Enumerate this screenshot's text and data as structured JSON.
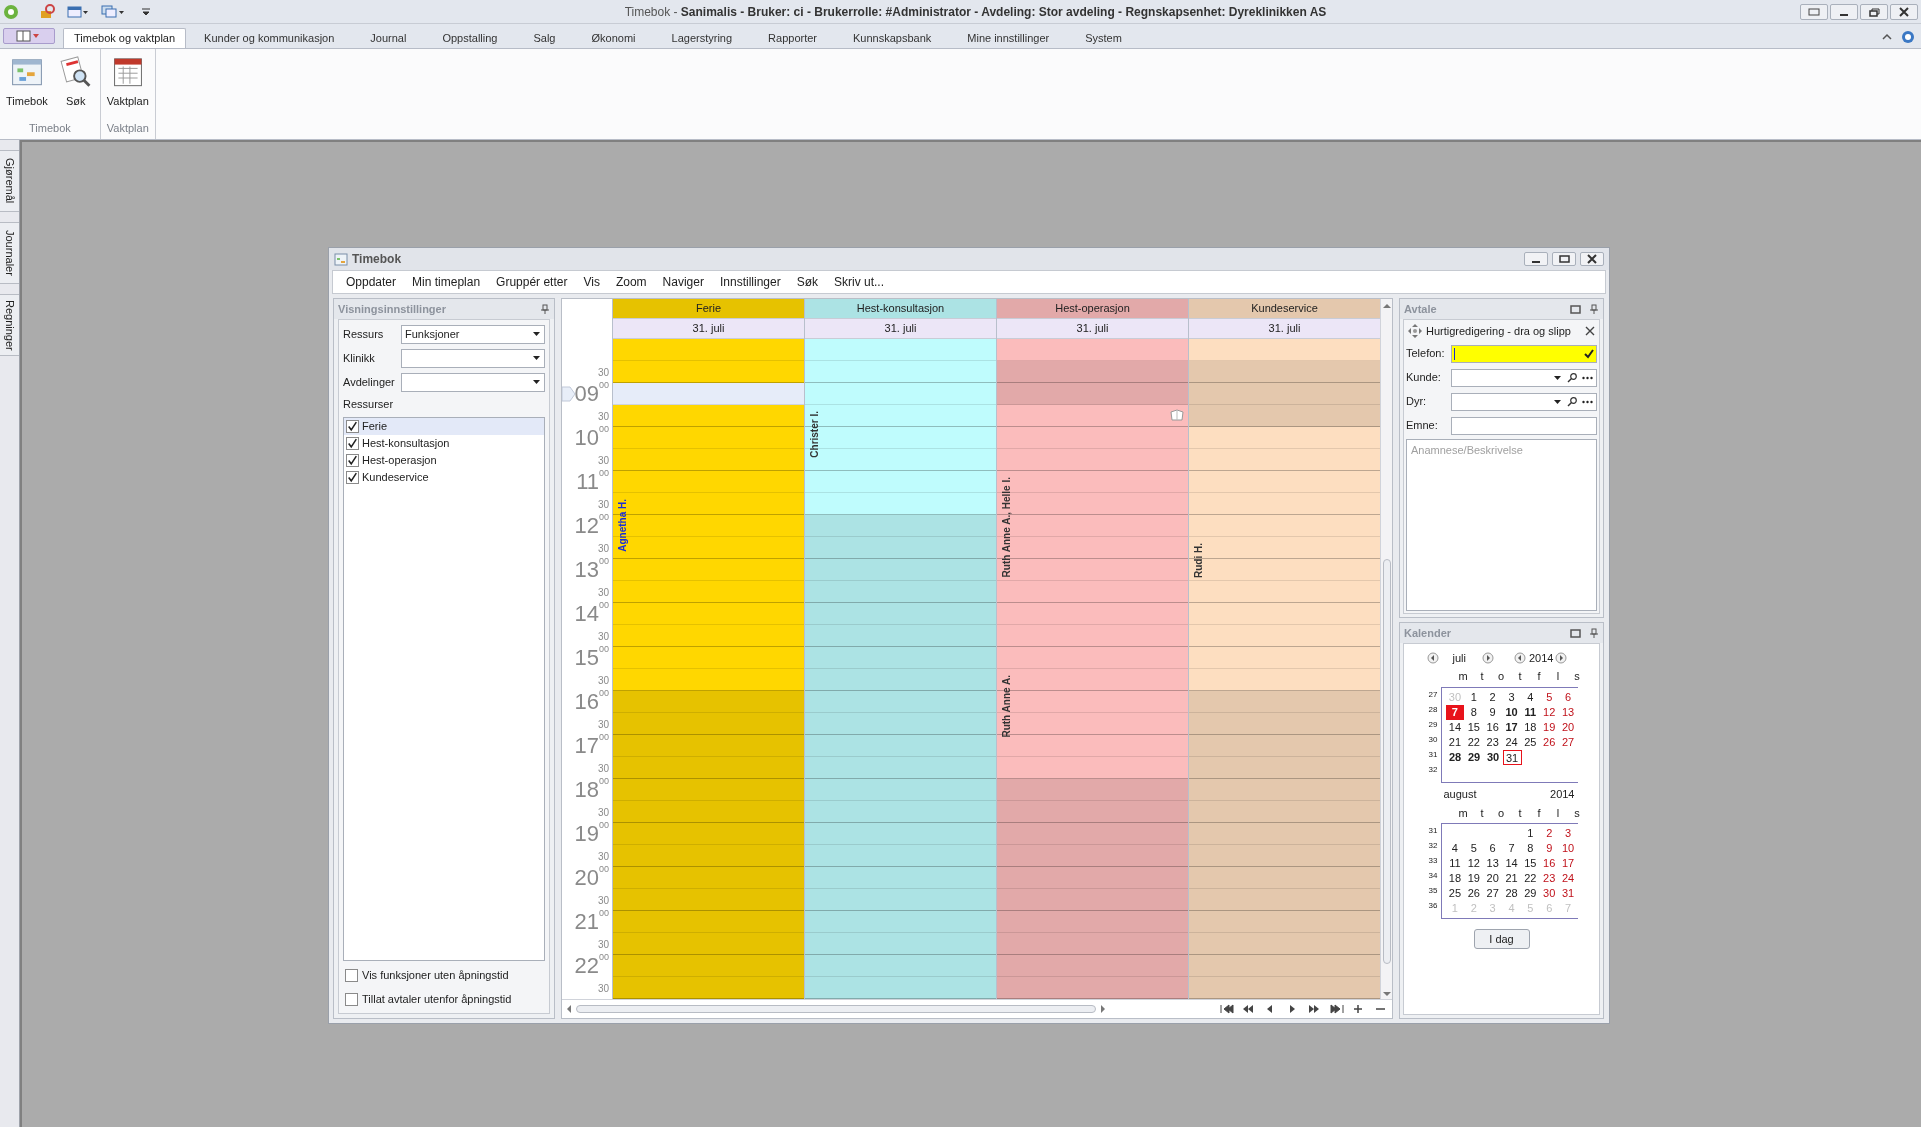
{
  "title_bar": {
    "title": "Timebok - **Sanimalis  -  Bruker: ci  -  Brukerrolle: #Administrator  -  Avdeling: Stor avdeling  -  Regnskapsenhet: Dyreklinikken AS**"
  },
  "ribbon": {
    "tabs": [
      {
        "label": "Timebok og vaktplan",
        "selected": true
      },
      {
        "label": "Kunder og kommunikasjon",
        "selected": false
      },
      {
        "label": "Journal",
        "selected": false
      },
      {
        "label": "Oppstalling",
        "selected": false
      },
      {
        "label": "Salg",
        "selected": false
      },
      {
        "label": "Økonomi",
        "selected": false
      },
      {
        "label": "Lagerstyring",
        "selected": false
      },
      {
        "label": "Rapporter",
        "selected": false
      },
      {
        "label": "Kunnskapsbank",
        "selected": false
      },
      {
        "label": "Mine innstillinger",
        "selected": false
      },
      {
        "label": "System",
        "selected": false
      }
    ],
    "groups": [
      {
        "label": "Timebok",
        "buttons": [
          {
            "label": "Timebok",
            "kind": "calendar"
          },
          {
            "label": "Søk",
            "kind": "search"
          }
        ]
      },
      {
        "label": "Vaktplan",
        "buttons": [
          {
            "label": "Vaktplan",
            "kind": "schedule"
          }
        ]
      }
    ]
  },
  "side_tabs": [
    "Gjøremål",
    "Journaler",
    "Regninger"
  ],
  "window": {
    "title": "Timebok",
    "menu": [
      "Oppdater",
      "Min timeplan",
      "Gruppér etter",
      "Vis",
      "Zoom",
      "Naviger",
      "Innstillinger",
      "Søk",
      "Skriv ut..."
    ],
    "view_settings": {
      "title": "Visningsinnstillinger",
      "fields": [
        {
          "label": "Ressurs",
          "value": "Funksjoner"
        },
        {
          "label": "Klinikk"
        },
        {
          "label": "Avdelinger"
        }
      ],
      "resources_label": "Ressurser",
      "resources": [
        {
          "label": "Ferie",
          "checked": true,
          "selected": true
        },
        {
          "label": "Hest-konsultasjon",
          "checked": true,
          "selected": false
        },
        {
          "label": "Hest-operasjon",
          "checked": true,
          "selected": false
        },
        {
          "label": "Kundeservice",
          "checked": true,
          "selected": false
        }
      ],
      "options": [
        {
          "label": "Vis funksjoner uten åpningstid",
          "checked": false
        },
        {
          "label": "Tillat avtaler utenfor åpningstid",
          "checked": false
        }
      ]
    },
    "schedule": {
      "time_labels": [
        {
          "kind": "half",
          "text": "30"
        },
        {
          "kind": "hour",
          "text": "09",
          "minutes": "00"
        },
        {
          "kind": "half",
          "text": "30"
        },
        {
          "kind": "hour",
          "text": "10",
          "minutes": "00"
        },
        {
          "kind": "half",
          "text": "30"
        },
        {
          "kind": "hour",
          "text": "11",
          "minutes": "00"
        },
        {
          "kind": "half",
          "text": "30"
        },
        {
          "kind": "hour",
          "text": "12",
          "minutes": "00"
        },
        {
          "kind": "half",
          "text": "30"
        },
        {
          "kind": "hour",
          "text": "13",
          "minutes": "00"
        },
        {
          "kind": "half",
          "text": "30"
        },
        {
          "kind": "hour",
          "text": "14",
          "minutes": "00"
        },
        {
          "kind": "half",
          "text": "30"
        },
        {
          "kind": "hour",
          "text": "15",
          "minutes": "00"
        },
        {
          "kind": "half",
          "text": "30"
        },
        {
          "kind": "hour",
          "text": "16",
          "minutes": "00"
        },
        {
          "kind": "half",
          "text": "30"
        },
        {
          "kind": "hour",
          "text": "17",
          "minutes": "00"
        },
        {
          "kind": "half",
          "text": "30"
        },
        {
          "kind": "hour",
          "text": "18",
          "minutes": "00"
        },
        {
          "kind": "half",
          "text": "30"
        },
        {
          "kind": "hour",
          "text": "19",
          "minutes": "00"
        },
        {
          "kind": "half",
          "text": "30"
        },
        {
          "kind": "hour",
          "text": "20",
          "minutes": "00"
        },
        {
          "kind": "half",
          "text": "30"
        },
        {
          "kind": "hour",
          "text": "21",
          "minutes": "00"
        },
        {
          "kind": "half",
          "text": "30"
        },
        {
          "kind": "hour",
          "text": "22",
          "minutes": "00"
        },
        {
          "kind": "half",
          "text": "30"
        }
      ],
      "columns": [
        {
          "name": "Ferie",
          "date": "31. juli",
          "color": "#ffd700",
          "slots": [
            {
              "open": true,
              "selected": false
            },
            {
              "open": true,
              "selected": false
            },
            {
              "open": true,
              "selected": true
            },
            {
              "open": true,
              "selected": false
            },
            {
              "open": true,
              "selected": false
            },
            {
              "open": true,
              "selected": false
            },
            {
              "open": true,
              "selected": false
            },
            {
              "open": true,
              "selected": false,
              "appointment": {
                "kind": "label",
                "text": "Agnetha H.",
                "color": "#1b2fd8"
              }
            },
            {
              "open": true,
              "selected": false
            },
            {
              "open": true,
              "selected": false
            },
            {
              "open": true,
              "selected": false
            },
            {
              "open": true,
              "selected": false
            },
            {
              "open": true,
              "selected": false
            },
            {
              "open": true,
              "selected": false
            },
            {
              "open": true,
              "selected": false
            },
            {
              "open": true,
              "selected": false
            },
            {
              "open": false,
              "selected": false
            },
            {
              "open": false,
              "selected": false
            },
            {
              "open": false,
              "selected": false
            },
            {
              "open": false,
              "selected": false
            },
            {
              "open": false,
              "selected": false
            },
            {
              "open": false,
              "selected": false
            },
            {
              "open": false,
              "selected": false
            },
            {
              "open": false,
              "selected": false
            },
            {
              "open": false,
              "selected": false
            },
            {
              "open": false,
              "selected": false
            },
            {
              "open": false,
              "selected": false
            },
            {
              "open": false,
              "selected": false
            },
            {
              "open": false,
              "selected": false
            },
            {
              "open": false,
              "selected": false
            }
          ]
        },
        {
          "name": "Hest-konsultasjon",
          "date": "31. juli",
          "color": "#bffcfd",
          "slots": [
            {
              "open": true,
              "selected": false
            },
            {
              "open": true,
              "selected": false
            },
            {
              "open": true,
              "selected": false
            },
            {
              "open": true,
              "selected": false,
              "appointment": {
                "kind": "label",
                "text": "Christer I.",
                "color": "#333333"
              }
            },
            {
              "open": true,
              "selected": false
            },
            {
              "open": true,
              "selected": false
            },
            {
              "open": true,
              "selected": false
            },
            {
              "open": true,
              "selected": false
            },
            {
              "open": false,
              "selected": false
            },
            {
              "open": false,
              "selected": false
            },
            {
              "open": false,
              "selected": false
            },
            {
              "open": false,
              "selected": false
            },
            {
              "open": false,
              "selected": false
            },
            {
              "open": false,
              "selected": false
            },
            {
              "open": false,
              "selected": false
            },
            {
              "open": false,
              "selected": false
            },
            {
              "open": false,
              "selected": false
            },
            {
              "open": false,
              "selected": false
            },
            {
              "open": false,
              "selected": false
            },
            {
              "open": false,
              "selected": false
            },
            {
              "open": false,
              "selected": false
            },
            {
              "open": false,
              "selected": false
            },
            {
              "open": false,
              "selected": false
            },
            {
              "open": false,
              "selected": false
            },
            {
              "open": false,
              "selected": false
            },
            {
              "open": false,
              "selected": false
            },
            {
              "open": false,
              "selected": false
            },
            {
              "open": false,
              "selected": false
            },
            {
              "open": false,
              "selected": false
            },
            {
              "open": false,
              "selected": false
            }
          ]
        },
        {
          "name": "Hest-operasjon",
          "date": "31. juli",
          "color": "#fbbcbc",
          "slots": [
            {
              "open": true,
              "selected": false
            },
            {
              "open": false,
              "selected": false
            },
            {
              "open": false,
              "selected": false
            },
            {
              "open": true,
              "selected": false,
              "appointment": {
                "kind": "icon"
              }
            },
            {
              "open": true,
              "selected": false
            },
            {
              "open": true,
              "selected": false
            },
            {
              "open": true,
              "selected": false,
              "appointment": {
                "kind": "label",
                "text": "Ruth Anne A., Helle I.",
                "color": "#333333"
              }
            },
            {
              "open": true,
              "selected": false
            },
            {
              "open": true,
              "selected": false
            },
            {
              "open": true,
              "selected": false
            },
            {
              "open": true,
              "selected": false
            },
            {
              "open": true,
              "selected": false
            },
            {
              "open": true,
              "selected": false
            },
            {
              "open": true,
              "selected": false
            },
            {
              "open": true,
              "selected": false
            },
            {
              "open": true,
              "selected": false,
              "appointment": {
                "kind": "label",
                "text": "Ruth Anne A.",
                "color": "#333333"
              }
            },
            {
              "open": true,
              "selected": false
            },
            {
              "open": true,
              "selected": false
            },
            {
              "open": true,
              "selected": false
            },
            {
              "open": true,
              "selected": false
            },
            {
              "open": false,
              "selected": false
            },
            {
              "open": false,
              "selected": false
            },
            {
              "open": false,
              "selected": false
            },
            {
              "open": false,
              "selected": false
            },
            {
              "open": false,
              "selected": false
            },
            {
              "open": false,
              "selected": false
            },
            {
              "open": false,
              "selected": false
            },
            {
              "open": false,
              "selected": false
            },
            {
              "open": false,
              "selected": false
            },
            {
              "open": false,
              "selected": false
            }
          ]
        },
        {
          "name": "Kundeservice",
          "date": "31. juli",
          "color": "#fddec0",
          "slots": [
            {
              "open": true,
              "selected": false
            },
            {
              "open": false,
              "selected": false
            },
            {
              "open": false,
              "selected": false
            },
            {
              "open": false,
              "selected": false
            },
            {
              "open": true,
              "selected": false
            },
            {
              "open": true,
              "selected": false
            },
            {
              "open": true,
              "selected": false
            },
            {
              "open": true,
              "selected": false
            },
            {
              "open": true,
              "selected": false
            },
            {
              "open": true,
              "selected": false,
              "appointment": {
                "kind": "label",
                "text": "Rudi H.",
                "color": "#333333"
              }
            },
            {
              "open": true,
              "selected": false
            },
            {
              "open": true,
              "selected": false
            },
            {
              "open": true,
              "selected": false
            },
            {
              "open": true,
              "selected": false
            },
            {
              "open": true,
              "selected": false
            },
            {
              "open": true,
              "selected": false
            },
            {
              "open": false,
              "selected": false
            },
            {
              "open": false,
              "selected": false
            },
            {
              "open": false,
              "selected": false
            },
            {
              "open": false,
              "selected": false
            },
            {
              "open": false,
              "selected": false
            },
            {
              "open": false,
              "selected": false
            },
            {
              "open": false,
              "selected": false
            },
            {
              "open": false,
              "selected": false
            },
            {
              "open": false,
              "selected": false
            },
            {
              "open": false,
              "selected": false
            },
            {
              "open": false,
              "selected": false
            },
            {
              "open": false,
              "selected": false
            },
            {
              "open": false,
              "selected": false
            },
            {
              "open": false,
              "selected": false
            }
          ]
        }
      ]
    },
    "appointment_panel": {
      "title": "Avtale",
      "quick_edit": "Hurtigredigering - dra og slipp",
      "fields": [
        {
          "label": "Telefon:",
          "kind": "phone"
        },
        {
          "label": "Kunde:",
          "kind": "lookup"
        },
        {
          "label": "Dyr:",
          "kind": "lookup"
        },
        {
          "label": "Emne:",
          "kind": "text"
        }
      ],
      "description_placeholder": "Anamnese/Beskrivelse"
    },
    "calendar_panel": {
      "title": "Kalender",
      "today_button": "I dag",
      "months": [
        {
          "name": "juli",
          "year": "2014",
          "navigation": true,
          "weekdays": [
            "m",
            "t",
            "o",
            "t",
            "f",
            "l",
            "s"
          ],
          "weeks": [
            {
              "week": "27",
              "days": [
                {
                  "text": "30",
                  "muted": true,
                  "bold": false,
                  "today": false,
                  "selected": false
                },
                {
                  "text": "1",
                  "muted": false,
                  "bold": false,
                  "today": false,
                  "selected": false
                },
                {
                  "text": "2",
                  "muted": false,
                  "bold": false,
                  "today": false,
                  "selected": false
                },
                {
                  "text": "3",
                  "muted": false,
                  "bold": false,
                  "today": false,
                  "selected": false
                },
                {
                  "text": "4",
                  "muted": false,
                  "bold": false,
                  "today": false,
                  "selected": false
                },
                {
                  "text": "5",
                  "muted": false,
                  "bold": false,
                  "today": false,
                  "selected": false
                },
                {
                  "text": "6",
                  "muted": false,
                  "bold": false,
                  "today": false,
                  "selected": false
                }
              ]
            },
            {
              "week": "28",
              "days": [
                {
                  "text": "7",
                  "muted": false,
                  "bold": true,
                  "today": true,
                  "selected": false
                },
                {
                  "text": "8",
                  "muted": false,
                  "bold": false,
                  "today": false,
                  "selected": false
                },
                {
                  "text": "9",
                  "muted": false,
                  "bold": false,
                  "today": false,
                  "selected": false
                },
                {
                  "text": "10",
                  "muted": false,
                  "bold": true,
                  "today": false,
                  "selected": false
                },
                {
                  "text": "11",
                  "muted": false,
                  "bold": true,
                  "today": false,
                  "selected": false
                },
                {
                  "text": "12",
                  "muted": false,
                  "bold": false,
                  "today": false,
                  "selected": false
                },
                {
                  "text": "13",
                  "muted": false,
                  "bold": false,
                  "today": false,
                  "selected": false
                }
              ]
            },
            {
              "week": "29",
              "days": [
                {
                  "text": "14",
                  "muted": false,
                  "bold": false,
                  "today": false,
                  "selected": false
                },
                {
                  "text": "15",
                  "muted": false,
                  "bold": false,
                  "today": false,
                  "selected": false
                },
                {
                  "text": "16",
                  "muted": false,
                  "bold": false,
                  "today": false,
                  "selected": false
                },
                {
                  "text": "17",
                  "muted": false,
                  "bold": true,
                  "today": false,
                  "selected": false
                },
                {
                  "text": "18",
                  "muted": false,
                  "bold": false,
                  "today": false,
                  "selected": false
                },
                {
                  "text": "19",
                  "muted": false,
                  "bold": false,
                  "today": false,
                  "selected": false
                },
                {
                  "text": "20",
                  "muted": false,
                  "bold": false,
                  "today": false,
                  "selected": false
                }
              ]
            },
            {
              "week": "30",
              "days": [
                {
                  "text": "21",
                  "muted": false,
                  "bold": false,
                  "today": false,
                  "selected": false
                },
                {
                  "text": "22",
                  "muted": false,
                  "bold": false,
                  "today": false,
                  "selected": false
                },
                {
                  "text": "23",
                  "muted": false,
                  "bold": false,
                  "today": false,
                  "selected": false
                },
                {
                  "text": "24",
                  "muted": false,
                  "bold": false,
                  "today": false,
                  "selected": false
                },
                {
                  "text": "25",
                  "muted": false,
                  "bold": false,
                  "today": false,
                  "selected": false
                },
                {
                  "text": "26",
                  "muted": false,
                  "bold": false,
                  "today": false,
                  "selected": false
                },
                {
                  "text": "27",
                  "muted": false,
                  "bold": false,
                  "today": false,
                  "selected": false
                }
              ]
            },
            {
              "week": "31",
              "days": [
                {
                  "text": "28",
                  "muted": false,
                  "bold": true,
                  "today": false,
                  "selected": false
                },
                {
                  "text": "29",
                  "muted": false,
                  "bold": true,
                  "today": false,
                  "selected": false
                },
                {
                  "text": "30",
                  "muted": false,
                  "bold": true,
                  "today": false,
                  "selected": false
                },
                {
                  "text": "31",
                  "muted": false,
                  "bold": false,
                  "today": false,
                  "selected": true
                }
              ]
            },
            {
              "week": "32"
            }
          ]
        },
        {
          "name": "august",
          "year": "2014",
          "navigation": false,
          "weekdays": [
            "m",
            "t",
            "o",
            "t",
            "f",
            "l",
            "s"
          ],
          "weeks": [
            {
              "week": "31",
              "days": [
                {
                  "text": "1",
                  "muted": false,
                  "bold": false,
                  "today": false,
                  "selected": false
                },
                {
                  "text": "2",
                  "muted": false,
                  "bold": false,
                  "today": false,
                  "selected": false
                },
                {
                  "text": "3",
                  "muted": false,
                  "bold": false,
                  "today": false,
                  "selected": false
                }
              ]
            },
            {
              "week": "32",
              "days": [
                {
                  "text": "4",
                  "muted": false,
                  "bold": false,
                  "today": false,
                  "selected": false
                },
                {
                  "text": "5",
                  "muted": false,
                  "bold": false,
                  "today": false,
                  "selected": false
                },
                {
                  "text": "6",
                  "muted": false,
                  "bold": false,
                  "today": false,
                  "selected": false
                },
                {
                  "text": "7",
                  "muted": false,
                  "bold": false,
                  "today": false,
                  "selected": false
                },
                {
                  "text": "8",
                  "muted": false,
                  "bold": false,
                  "today": false,
                  "selected": false
                },
                {
                  "text": "9",
                  "muted": false,
                  "bold": false,
                  "today": false,
                  "selected": false
                },
                {
                  "text": "10",
                  "muted": false,
                  "bold": false,
                  "today": false,
                  "selected": false
                }
              ]
            },
            {
              "week": "33",
              "days": [
                {
                  "text": "11",
                  "muted": false,
                  "bold": false,
                  "today": false,
                  "selected": false
                },
                {
                  "text": "12",
                  "muted": false,
                  "bold": false,
                  "today": false,
                  "selected": false
                },
                {
                  "text": "13",
                  "muted": false,
                  "bold": false,
                  "today": false,
                  "selected": false
                },
                {
                  "text": "14",
                  "muted": false,
                  "bold": false,
                  "today": false,
                  "selected": false
                },
                {
                  "text": "15",
                  "muted": false,
                  "bold": false,
                  "today": false,
                  "selected": false
                },
                {
                  "text": "16",
                  "muted": false,
                  "bold": false,
                  "today": false,
                  "selected": false
                },
                {
                  "text": "17",
                  "muted": false,
                  "bold": false,
                  "today": false,
                  "selected": false
                }
              ]
            },
            {
              "week": "34",
              "days": [
                {
                  "text": "18",
                  "muted": false,
                  "bold": false,
                  "today": false,
                  "selected": false
                },
                {
                  "text": "19",
                  "muted": false,
                  "bold": false,
                  "today": false,
                  "selected": false
                },
                {
                  "text": "20",
                  "muted": false,
                  "bold": false,
                  "today": false,
                  "selected": false
                },
                {
                  "text": "21",
                  "muted": false,
                  "bold": false,
                  "today": false,
                  "selected": false
                },
                {
                  "text": "22",
                  "muted": false,
                  "bold": false,
                  "today": false,
                  "selected": false
                },
                {
                  "text": "23",
                  "muted": false,
                  "bold": false,
                  "today": false,
                  "selected": false
                },
                {
                  "text": "24",
                  "muted": false,
                  "bold": false,
                  "today": false,
                  "selected": false
                }
              ]
            },
            {
              "week": "35",
              "days": [
                {
                  "text": "25",
                  "muted": false,
                  "bold": false,
                  "today": false,
                  "selected": false
                },
                {
                  "text": "26",
                  "muted": false,
                  "bold": false,
                  "today": false,
                  "selected": false
                },
                {
                  "text": "27",
                  "muted": false,
                  "bold": false,
                  "today": false,
                  "selected": false
                },
                {
                  "text": "28",
                  "muted": false,
                  "bold": false,
                  "today": false,
                  "selected": false
                },
                {
                  "text": "29",
                  "muted": false,
                  "bold": false,
                  "today": false,
                  "selected": false
                },
                {
                  "text": "30",
                  "muted": false,
                  "bold": false,
                  "today": false,
                  "selected": false
                },
                {
                  "text": "31",
                  "muted": false,
                  "bold": false,
                  "today": false,
                  "selected": false
                }
              ]
            },
            {
              "week": "36",
              "days": [
                {
                  "text": "1",
                  "muted": true,
                  "bold": false,
                  "today": false,
                  "selected": false
                },
                {
                  "text": "2",
                  "muted": true,
                  "bold": false,
                  "today": false,
                  "selected": false
                },
                {
                  "text": "3",
                  "muted": true,
                  "bold": false,
                  "today": false,
                  "selected": false
                },
                {
                  "text": "4",
                  "muted": true,
                  "bold": false,
                  "today": false,
                  "selected": false
                },
                {
                  "text": "5",
                  "muted": true,
                  "bold": false,
                  "today": false,
                  "selected": false
                },
                {
                  "text": "6",
                  "muted": true,
                  "bold": false,
                  "today": false,
                  "selected": false
                },
                {
                  "text": "7",
                  "muted": true,
                  "bold": false,
                  "today": false,
                  "selected": false
                }
              ]
            }
          ]
        }
      ]
    }
  }
}
